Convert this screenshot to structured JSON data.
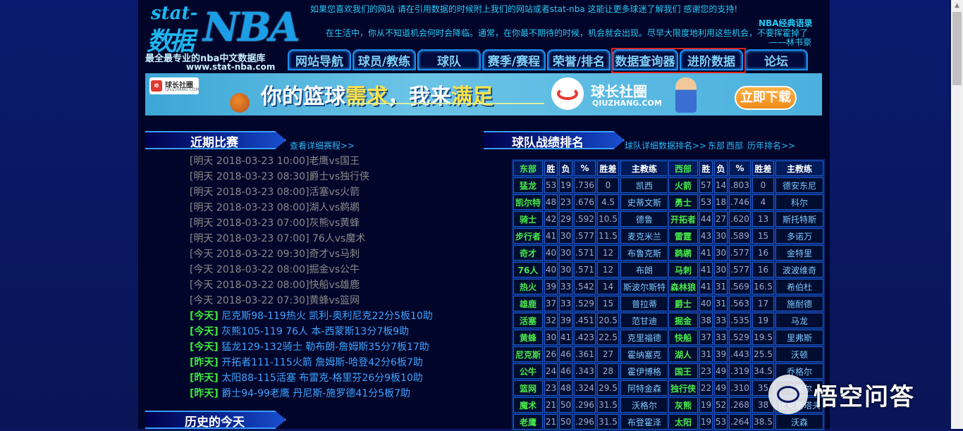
{
  "header": {
    "logo_stat": "stat-",
    "logo_shuju": "数据",
    "logo_nba": "NBA",
    "logo_subtitle": "最全最专业的nba中文数据库",
    "logo_url": "www.stat-nba.com",
    "notice": "如果您喜欢我们的网站 请在引用数据的时候附上我们的网站或者stat-nba 这能让更多球迷了解我们 感谢您的支持!",
    "quote_title": "NBA经典语录",
    "quote_text": "在生活中，你从不知道机会何时会降临。通常，在你最不期待的时候，机会就会出现。尽早大限度地利用这些机会，不要挥霍掉了",
    "quote_author": "——林书豪"
  },
  "nav": {
    "tabs": [
      "网站导航",
      "球员/教练",
      "球队",
      "赛季/赛程",
      "荣誉/排名",
      "数据查询器",
      "进阶数据",
      "论坛"
    ]
  },
  "banner": {
    "brand_name": "球长社圈",
    "brand_site": "QIUZHANG.COM",
    "slogan_a": "你的篮球",
    "slogan_b": "需求",
    "slogan_c": "，我来",
    "slogan_d": "满足",
    "app_name": "球长社圈",
    "app_site": "QIUZHANG.COM",
    "download": "立即下载"
  },
  "recent": {
    "title": "近期比赛",
    "more": "查看详细赛程>>",
    "future": [
      "[明天 2018-03-23 10:00]老鹰vs国王",
      "[明天 2018-03-23 08:30]爵士vs独行侠",
      "[明天 2018-03-23 08:00]活塞vs火箭",
      "[明天 2018-03-23 08:00]湖人vs鹈鹕",
      "[明天 2018-03-23 07:00]灰熊vs黄蜂",
      "[明天 2018-03-23 07:00] 76人vs魔术",
      "[今天 2018-03-22 09:30]奇才vs马刺",
      "[今天 2018-03-22 08:00]掘金vs公牛",
      "[今天 2018-03-22 08:00]快船vs雄鹿",
      "[今天 2018-03-22 07:30]黄蜂vs篮网"
    ],
    "done": [
      {
        "tag": "[今天]",
        "text": " 尼克斯98-119热火 凯利-奥利尼克22分5板10助"
      },
      {
        "tag": "[今天]",
        "text": " 灰熊105-119 76人 本-西蒙斯13分7板9助"
      },
      {
        "tag": "[今天]",
        "text": " 猛龙129-132骑士 勒布朗-詹姆斯35分7板17助"
      },
      {
        "tag": "[昨天]",
        "text": " 开拓者111-115火箭 詹姆斯-哈登42分6板7助"
      },
      {
        "tag": "[昨天]",
        "text": " 太阳88-115活塞 布雷克-格里芬26分9板10助"
      },
      {
        "tag": "[昨天]",
        "text": " 爵士94-99老鹰 丹尼斯-施罗德41分5板7助"
      }
    ]
  },
  "standings": {
    "title": "球队战绩排名",
    "more_links": [
      "球队详细数据排名>>",
      "东部",
      "西部",
      "历年排名>>"
    ],
    "east_headers": [
      "东部",
      "胜",
      "负",
      "%",
      "胜差",
      "主教练"
    ],
    "west_headers": [
      "西部",
      "胜",
      "负",
      "%",
      "胜差",
      "主教练"
    ],
    "east": [
      [
        "猛龙",
        "53",
        "19",
        ".736",
        "0",
        "凯西"
      ],
      [
        "凯尔特",
        "48",
        "23",
        ".676",
        "4.5",
        "史蒂文斯"
      ],
      [
        "骑士",
        "42",
        "29",
        ".592",
        "10.5",
        "德鲁"
      ],
      [
        "步行者",
        "41",
        "30",
        ".577",
        "11.5",
        "麦克米兰"
      ],
      [
        "奇才",
        "40",
        "30",
        ".571",
        "12",
        "布鲁克斯"
      ],
      [
        "76人",
        "40",
        "30",
        ".571",
        "12",
        "布朗"
      ],
      [
        "热火",
        "39",
        "33",
        ".542",
        "14",
        "斯波尔斯特"
      ],
      [
        "雄鹿",
        "37",
        "33",
        ".529",
        "15",
        "普拉蒂"
      ],
      [
        "活塞",
        "32",
        "39",
        ".451",
        "20.5",
        "范甘迪"
      ],
      [
        "黄蜂",
        "30",
        "41",
        ".423",
        "22.5",
        "克里福德"
      ],
      [
        "尼克斯",
        "26",
        "46",
        ".361",
        "27",
        "霍纳塞克"
      ],
      [
        "公牛",
        "24",
        "46",
        ".343",
        "28",
        "霍伊博格"
      ],
      [
        "篮网",
        "23",
        "48",
        ".324",
        "29.5",
        "阿特金森"
      ],
      [
        "魔术",
        "21",
        "50",
        ".296",
        "31.5",
        "沃格尔"
      ],
      [
        "老鹰",
        "21",
        "50",
        ".296",
        "31.5",
        "布登霍泽"
      ]
    ],
    "west": [
      [
        "火箭",
        "57",
        "14",
        ".803",
        "0",
        "德安东尼"
      ],
      [
        "勇士",
        "53",
        "18",
        ".746",
        "4",
        "科尔"
      ],
      [
        "开拓者",
        "44",
        "27",
        ".620",
        "13",
        "斯托特斯"
      ],
      [
        "雷霆",
        "43",
        "30",
        ".589",
        "15",
        "多诺万"
      ],
      [
        "鹈鹕",
        "41",
        "30",
        ".577",
        "16",
        "金特里"
      ],
      [
        "马刺",
        "41",
        "30",
        ".577",
        "16",
        "波波维奇"
      ],
      [
        "森林狼",
        "41",
        "31",
        ".569",
        "16.5",
        "希伯杜"
      ],
      [
        "爵士",
        "40",
        "31",
        ".563",
        "17",
        "施耐德"
      ],
      [
        "掘金",
        "38",
        "33",
        ".535",
        "19",
        "马龙"
      ],
      [
        "快船",
        "37",
        "33",
        ".529",
        "19.5",
        "里弗斯"
      ],
      [
        "湖人",
        "31",
        "39",
        ".443",
        "25.5",
        "沃顿"
      ],
      [
        "国王",
        "23",
        "49",
        ".319",
        "34.5",
        "乔格尔"
      ],
      [
        "独行侠",
        "22",
        "49",
        ".310",
        "35",
        "卡莱尔"
      ],
      [
        "灰熊",
        "19",
        "52",
        ".268",
        "38",
        "比克斯塔夫"
      ],
      [
        "太阳",
        "19",
        "53",
        ".264",
        "38.5",
        "沃森"
      ]
    ]
  },
  "history": {
    "title": "历史的今天"
  },
  "watermark": {
    "text": "悟空问答"
  },
  "colors": {
    "page_bg": "#02052a",
    "accent": "#27c8f3",
    "nav_border": "#1c8ef5",
    "team_green": "#49e749",
    "highlight_red": "#e02020"
  }
}
